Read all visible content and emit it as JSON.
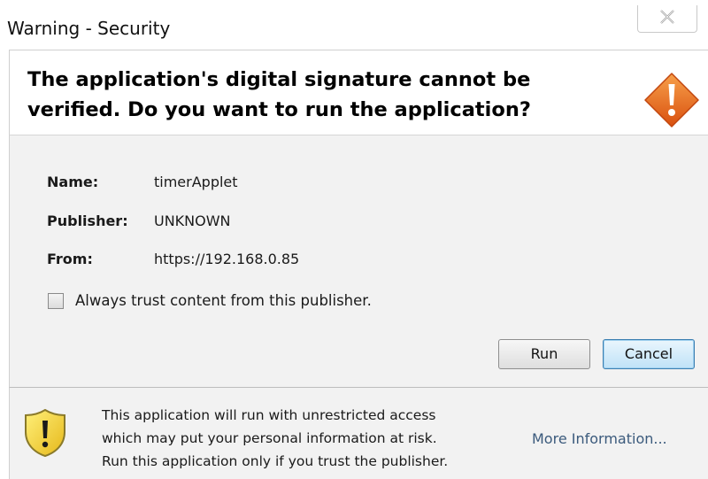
{
  "window": {
    "title": "Warning - Security"
  },
  "header": {
    "message": "The application's digital signature cannot be verified.  Do you want to run the application?"
  },
  "details": {
    "name_label": "Name:",
    "name_value": "timerApplet",
    "publisher_label": "Publisher:",
    "publisher_value": "UNKNOWN",
    "from_label": "From:",
    "from_value": "https://192.168.0.85"
  },
  "trust_option": {
    "label": "Always trust content from this publisher.",
    "checked": false
  },
  "buttons": {
    "run_label": "Run",
    "cancel_label": "Cancel"
  },
  "footer": {
    "line1": "This application will run with unrestricted access",
    "line2": "which may put your personal information at risk.",
    "line3": "Run this application only if you trust the publisher.",
    "more_info_label": "More Information..."
  },
  "icons": {
    "header_icon": "warning-diamond-icon",
    "footer_icon": "shield-warning-icon",
    "close_icon": "close-icon"
  },
  "colors": {
    "warning_orange": "#e8641b",
    "shield_yellow": "#f2cf2a",
    "link_blue": "#3b5a7c",
    "cancel_button_blue": "#bfe2f7"
  }
}
